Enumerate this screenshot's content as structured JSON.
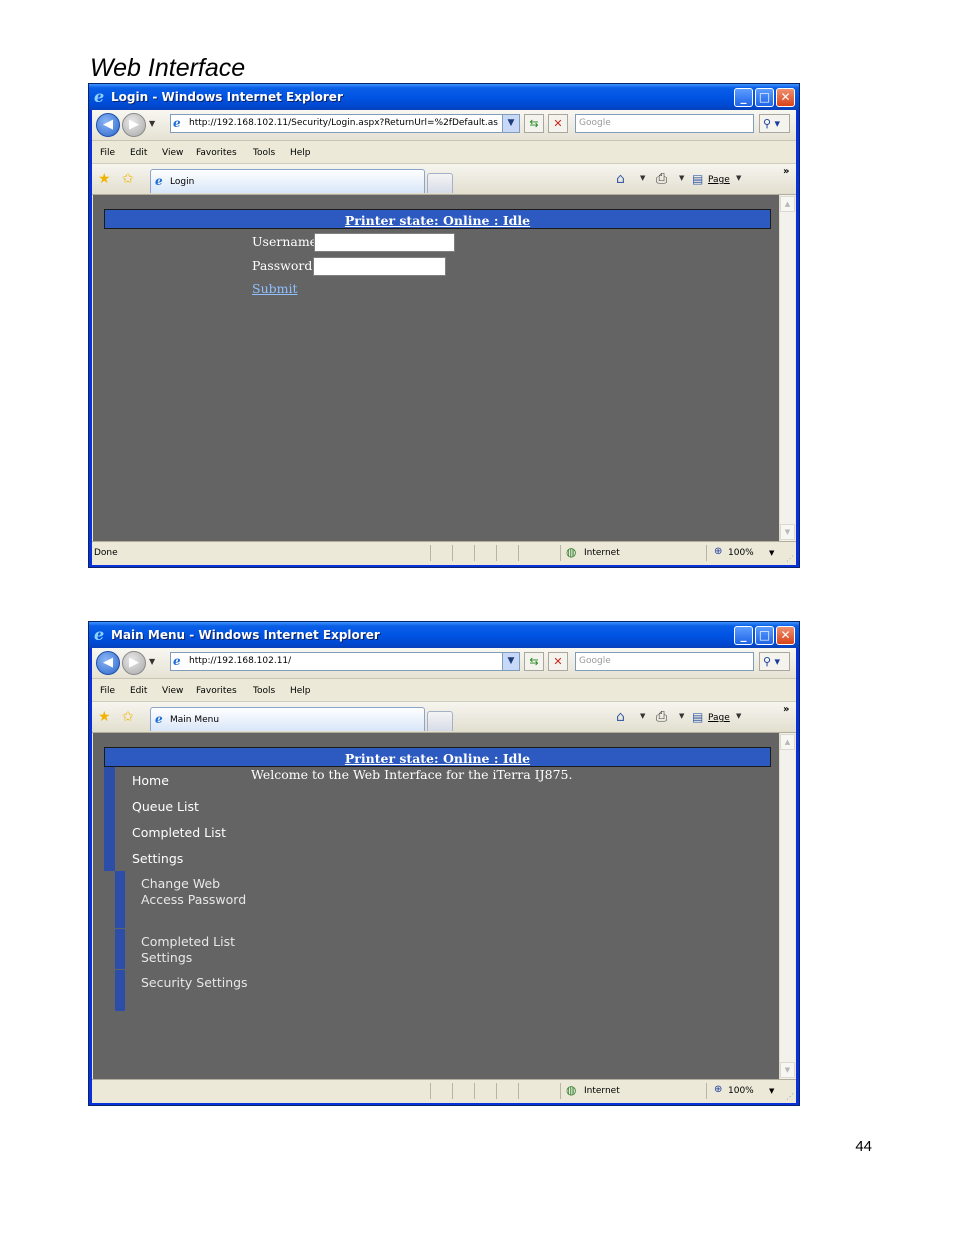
{
  "page": {
    "heading": "Web Interface",
    "page_number": "44"
  },
  "common": {
    "menu": [
      "File",
      "Edit",
      "View",
      "Favorites",
      "Tools",
      "Help"
    ],
    "search_placeholder": "Google",
    "page_menu": "Page",
    "zone": "Internet",
    "zoom": "100%",
    "printer_state": "Printer state: Online : Idle"
  },
  "login_window": {
    "title": "Login - Windows Internet Explorer",
    "url": "http://192.168.102.11/Security/Login.aspx?ReturnUrl=%2fDefault.as",
    "tab_label": "Login",
    "status": "Done",
    "username_label": "Username:",
    "password_label": "Password:",
    "username_value": "",
    "password_value": "",
    "submit_label": "Submit"
  },
  "main_window": {
    "title": "Main Menu - Windows Internet Explorer",
    "url": "http://192.168.102.11/",
    "tab_label": "Main Menu",
    "status": "",
    "welcome": "Welcome to the Web Interface for the iTerra IJ875.",
    "menu_items": [
      "Home",
      "Queue List",
      "Completed List",
      "Settings"
    ],
    "settings_subitems": [
      "Change Web Access Password",
      "Completed List Settings",
      "Security Settings"
    ]
  }
}
